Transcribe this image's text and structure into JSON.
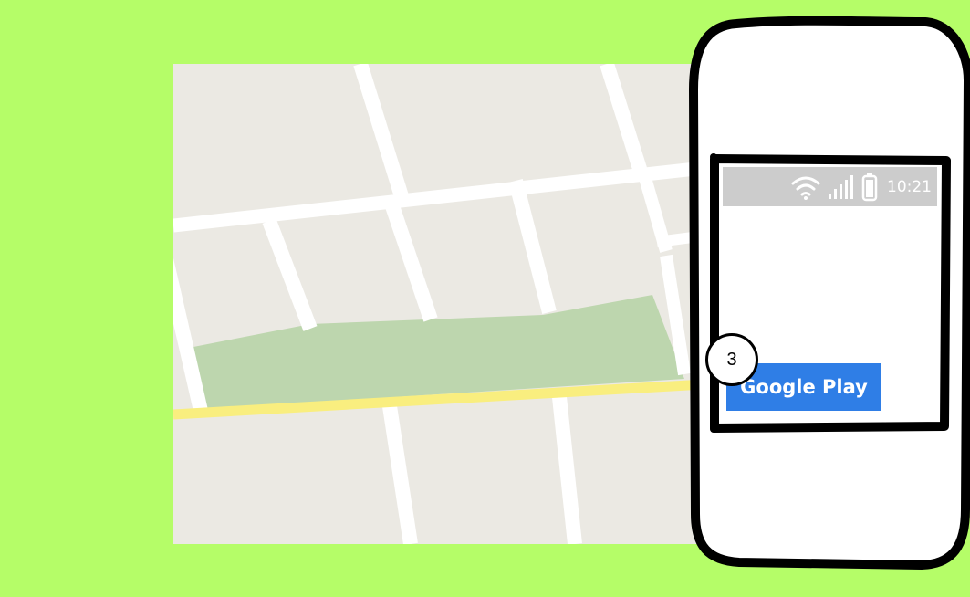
{
  "colors": {
    "background": "#b5fd68",
    "map_land": "#ebe9e3",
    "map_road": "#ffffff",
    "map_park": "#bdd6ae",
    "map_highway": "#f9ee7f",
    "status_bar": "#cccccc",
    "store_button": "#2f7ee6"
  },
  "map": {
    "icon": "map-placeholder"
  },
  "phone": {
    "status_bar": {
      "icons": [
        "wifi-icon",
        "signal-icon",
        "battery-icon"
      ],
      "time": "10:21"
    },
    "store_button_label": "Google Play"
  },
  "step_marker": {
    "number": "3"
  }
}
